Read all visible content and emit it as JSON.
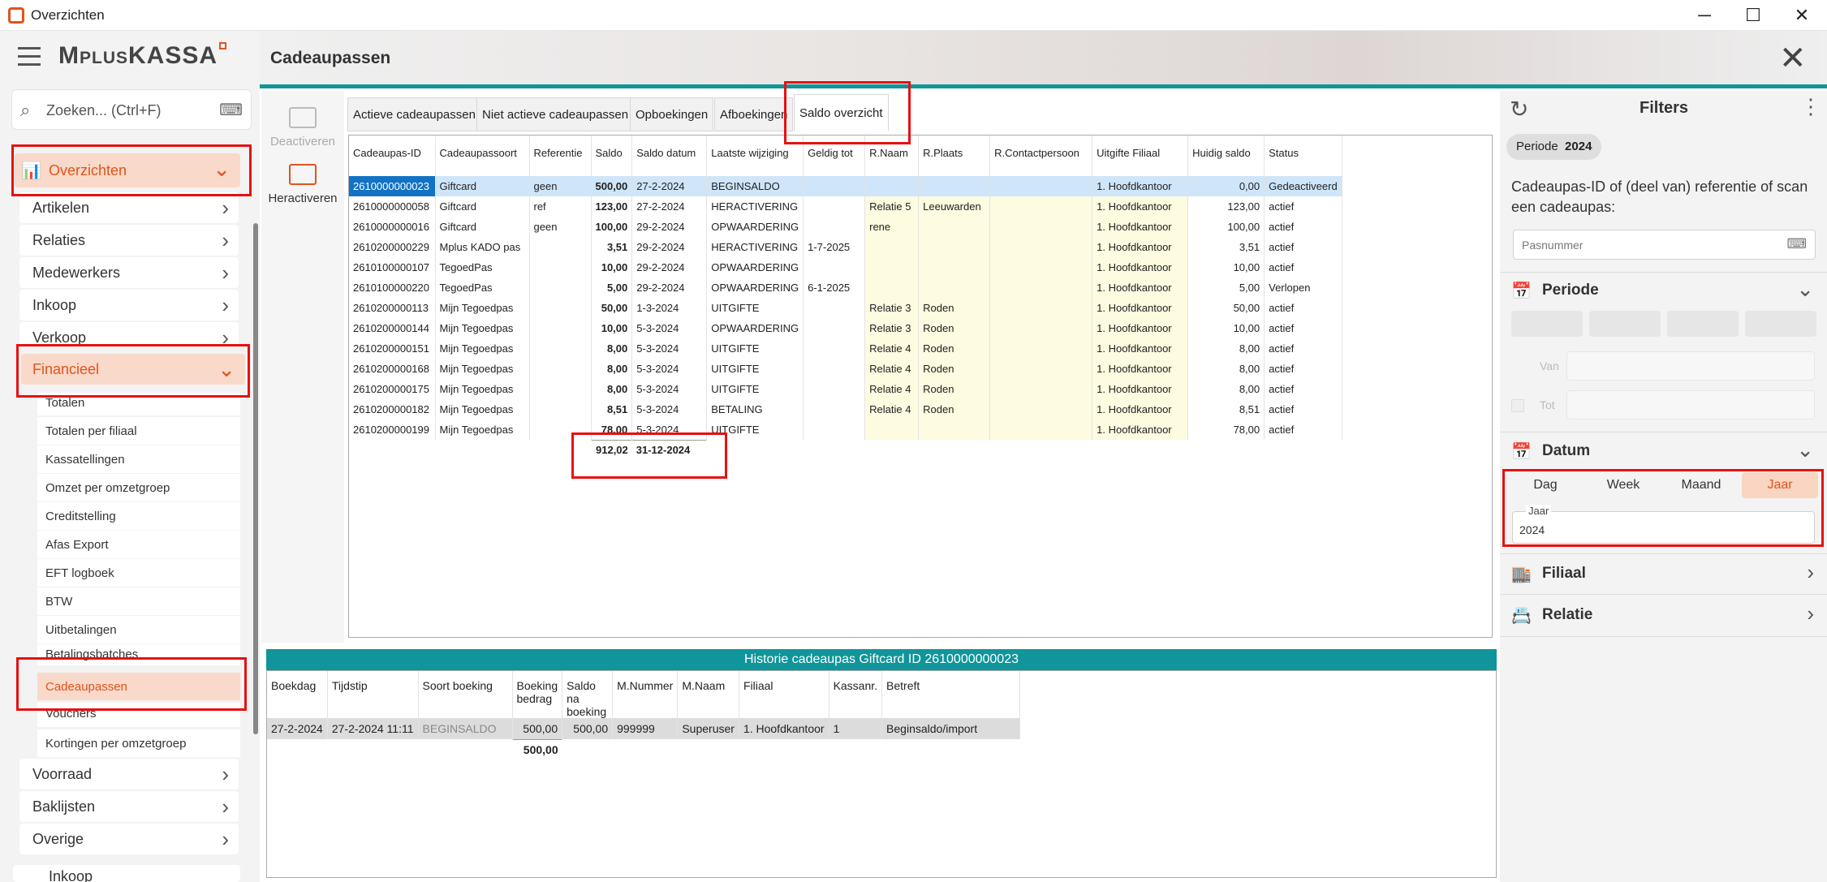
{
  "window": {
    "title": "Overzichten",
    "minimize": "─",
    "maximize": "☐",
    "close": "✕"
  },
  "app": {
    "logo_m": "M",
    "logo_plus": "PLUS",
    "logo_kassa": "KASSA"
  },
  "search": {
    "placeholder": "Zoeken... (Ctrl+F)"
  },
  "nav": {
    "overzichten": "Overzichten",
    "items": [
      "Artikelen",
      "Relaties",
      "Medewerkers",
      "Inkoop",
      "Verkoop"
    ],
    "financieel": "Financieel",
    "sub": [
      "Totalen",
      "Totalen per filiaal",
      "Kassatellingen",
      "Omzet per omzetgroep",
      "Creditstelling",
      "Afas Export",
      "EFT logboek",
      "BTW",
      "Uitbetalingen",
      "Betalingsbatches",
      "Cadeaupassen",
      "Vouchers",
      "Kortingen per omzetgroep"
    ],
    "after": [
      "Voorraad",
      "Baklijsten",
      "Overige",
      "Inkoop"
    ]
  },
  "header": {
    "title": "Cadeaupassen"
  },
  "toolbar": {
    "deactivate": "Deactiveren",
    "reactivate": "Heractiveren"
  },
  "tabs": [
    "Actieve cadeaupassen",
    "Niet actieve cadeaupassen",
    "Opboekingen",
    "Afboekingen",
    "Saldo overzicht"
  ],
  "grid": {
    "columns": [
      "Cadeaupas-ID",
      "Cadeaupassoort",
      "Referentie",
      "Saldo",
      "Saldo datum",
      "Laatste wijziging",
      "Geldig tot",
      "R.Naam",
      "R.Plaats",
      "R.Contactpersoon",
      "Uitgifte Filiaal",
      "Huidig saldo",
      "Status"
    ],
    "rows": [
      [
        "2610000000023",
        "Giftcard",
        "geen",
        "500,00",
        "27-2-2024",
        "BEGINSALDO",
        "",
        "",
        "",
        "",
        "1. Hoofdkantoor",
        "0,00",
        "Gedeactiveerd"
      ],
      [
        "2610000000058",
        "Giftcard",
        "ref",
        "123,00",
        "27-2-2024",
        "HERACTIVERING",
        "",
        "Relatie 5",
        "Leeuwarden",
        "",
        "1. Hoofdkantoor",
        "123,00",
        "actief"
      ],
      [
        "2610000000016",
        "Giftcard",
        "geen",
        "100,00",
        "29-2-2024",
        "OPWAARDERING",
        "",
        "rene",
        "",
        "",
        "1. Hoofdkantoor",
        "100,00",
        "actief"
      ],
      [
        "2610200000229",
        "Mplus KADO pas",
        "",
        "3,51",
        "29-2-2024",
        "HERACTIVERING",
        "1-7-2025",
        "",
        "",
        "",
        "1. Hoofdkantoor",
        "3,51",
        "actief"
      ],
      [
        "2610100000107",
        "TegoedPas",
        "",
        "10,00",
        "29-2-2024",
        "OPWAARDERING",
        "",
        "",
        "",
        "",
        "1. Hoofdkantoor",
        "10,00",
        "actief"
      ],
      [
        "2610100000220",
        "TegoedPas",
        "",
        "5,00",
        "29-2-2024",
        "OPWAARDERING",
        "6-1-2025",
        "",
        "",
        "",
        "1. Hoofdkantoor",
        "5,00",
        "Verlopen"
      ],
      [
        "2610200000113",
        "Mijn Tegoedpas",
        "",
        "50,00",
        "1-3-2024",
        "UITGIFTE",
        "",
        "Relatie 3",
        "Roden",
        "",
        "1. Hoofdkantoor",
        "50,00",
        "actief"
      ],
      [
        "2610200000144",
        "Mijn Tegoedpas",
        "",
        "10,00",
        "5-3-2024",
        "OPWAARDERING",
        "",
        "Relatie 3",
        "Roden",
        "",
        "1. Hoofdkantoor",
        "10,00",
        "actief"
      ],
      [
        "2610200000151",
        "Mijn Tegoedpas",
        "",
        "8,00",
        "5-3-2024",
        "UITGIFTE",
        "",
        "Relatie 4",
        "Roden",
        "",
        "1. Hoofdkantoor",
        "8,00",
        "actief"
      ],
      [
        "2610200000168",
        "Mijn Tegoedpas",
        "",
        "8,00",
        "5-3-2024",
        "UITGIFTE",
        "",
        "Relatie 4",
        "Roden",
        "",
        "1. Hoofdkantoor",
        "8,00",
        "actief"
      ],
      [
        "2610200000175",
        "Mijn Tegoedpas",
        "",
        "8,00",
        "5-3-2024",
        "UITGIFTE",
        "",
        "Relatie 4",
        "Roden",
        "",
        "1. Hoofdkantoor",
        "8,00",
        "actief"
      ],
      [
        "2610200000182",
        "Mijn Tegoedpas",
        "",
        "8,51",
        "5-3-2024",
        "BETALING",
        "",
        "Relatie 4",
        "Roden",
        "",
        "1. Hoofdkantoor",
        "8,51",
        "actief"
      ],
      [
        "2610200000199",
        "Mijn Tegoedpas",
        "",
        "78,00",
        "5-3-2024",
        "UITGIFTE",
        "",
        "",
        "",
        "",
        "1. Hoofdkantoor",
        "78,00",
        "actief"
      ]
    ],
    "total_saldo": "912,02",
    "total_date": "31-12-2024"
  },
  "history": {
    "title": "Historie cadeaupas Giftcard ID 2610000000023",
    "columns": [
      "Boekdag",
      "Tijdstip",
      "Soort boeking",
      "Boeking bedrag",
      "Saldo na boeking",
      "M.Nummer",
      "M.Naam",
      "Filiaal",
      "Kassanr.",
      "Betreft"
    ],
    "rows": [
      [
        "27-2-2024",
        "27-2-2024 11:11",
        "BEGINSALDO",
        "500,00",
        "500,00",
        "999999",
        "Superuser",
        "1. Hoofdkantoor",
        "1",
        "Beginsaldo/import"
      ]
    ],
    "total": "500,00"
  },
  "filters": {
    "title": "Filters",
    "chip_label": "Periode",
    "chip_value": "2024",
    "search_label": "Cadeaupas-ID of (deel van) referentie of scan een cadeaupas:",
    "search_placeholder": "Pasnummer",
    "periode": "Periode",
    "van": "Van",
    "tot": "Tot",
    "datum": "Datum",
    "segments": [
      "Dag",
      "Week",
      "Maand",
      "Jaar"
    ],
    "jaar_label": "Jaar",
    "jaar_value": "2024",
    "filiaal": "Filiaal",
    "relatie": "Relatie"
  },
  "colors": {
    "accent": "#e0541c",
    "teal": "#10959a",
    "highlight": "#e81010"
  }
}
